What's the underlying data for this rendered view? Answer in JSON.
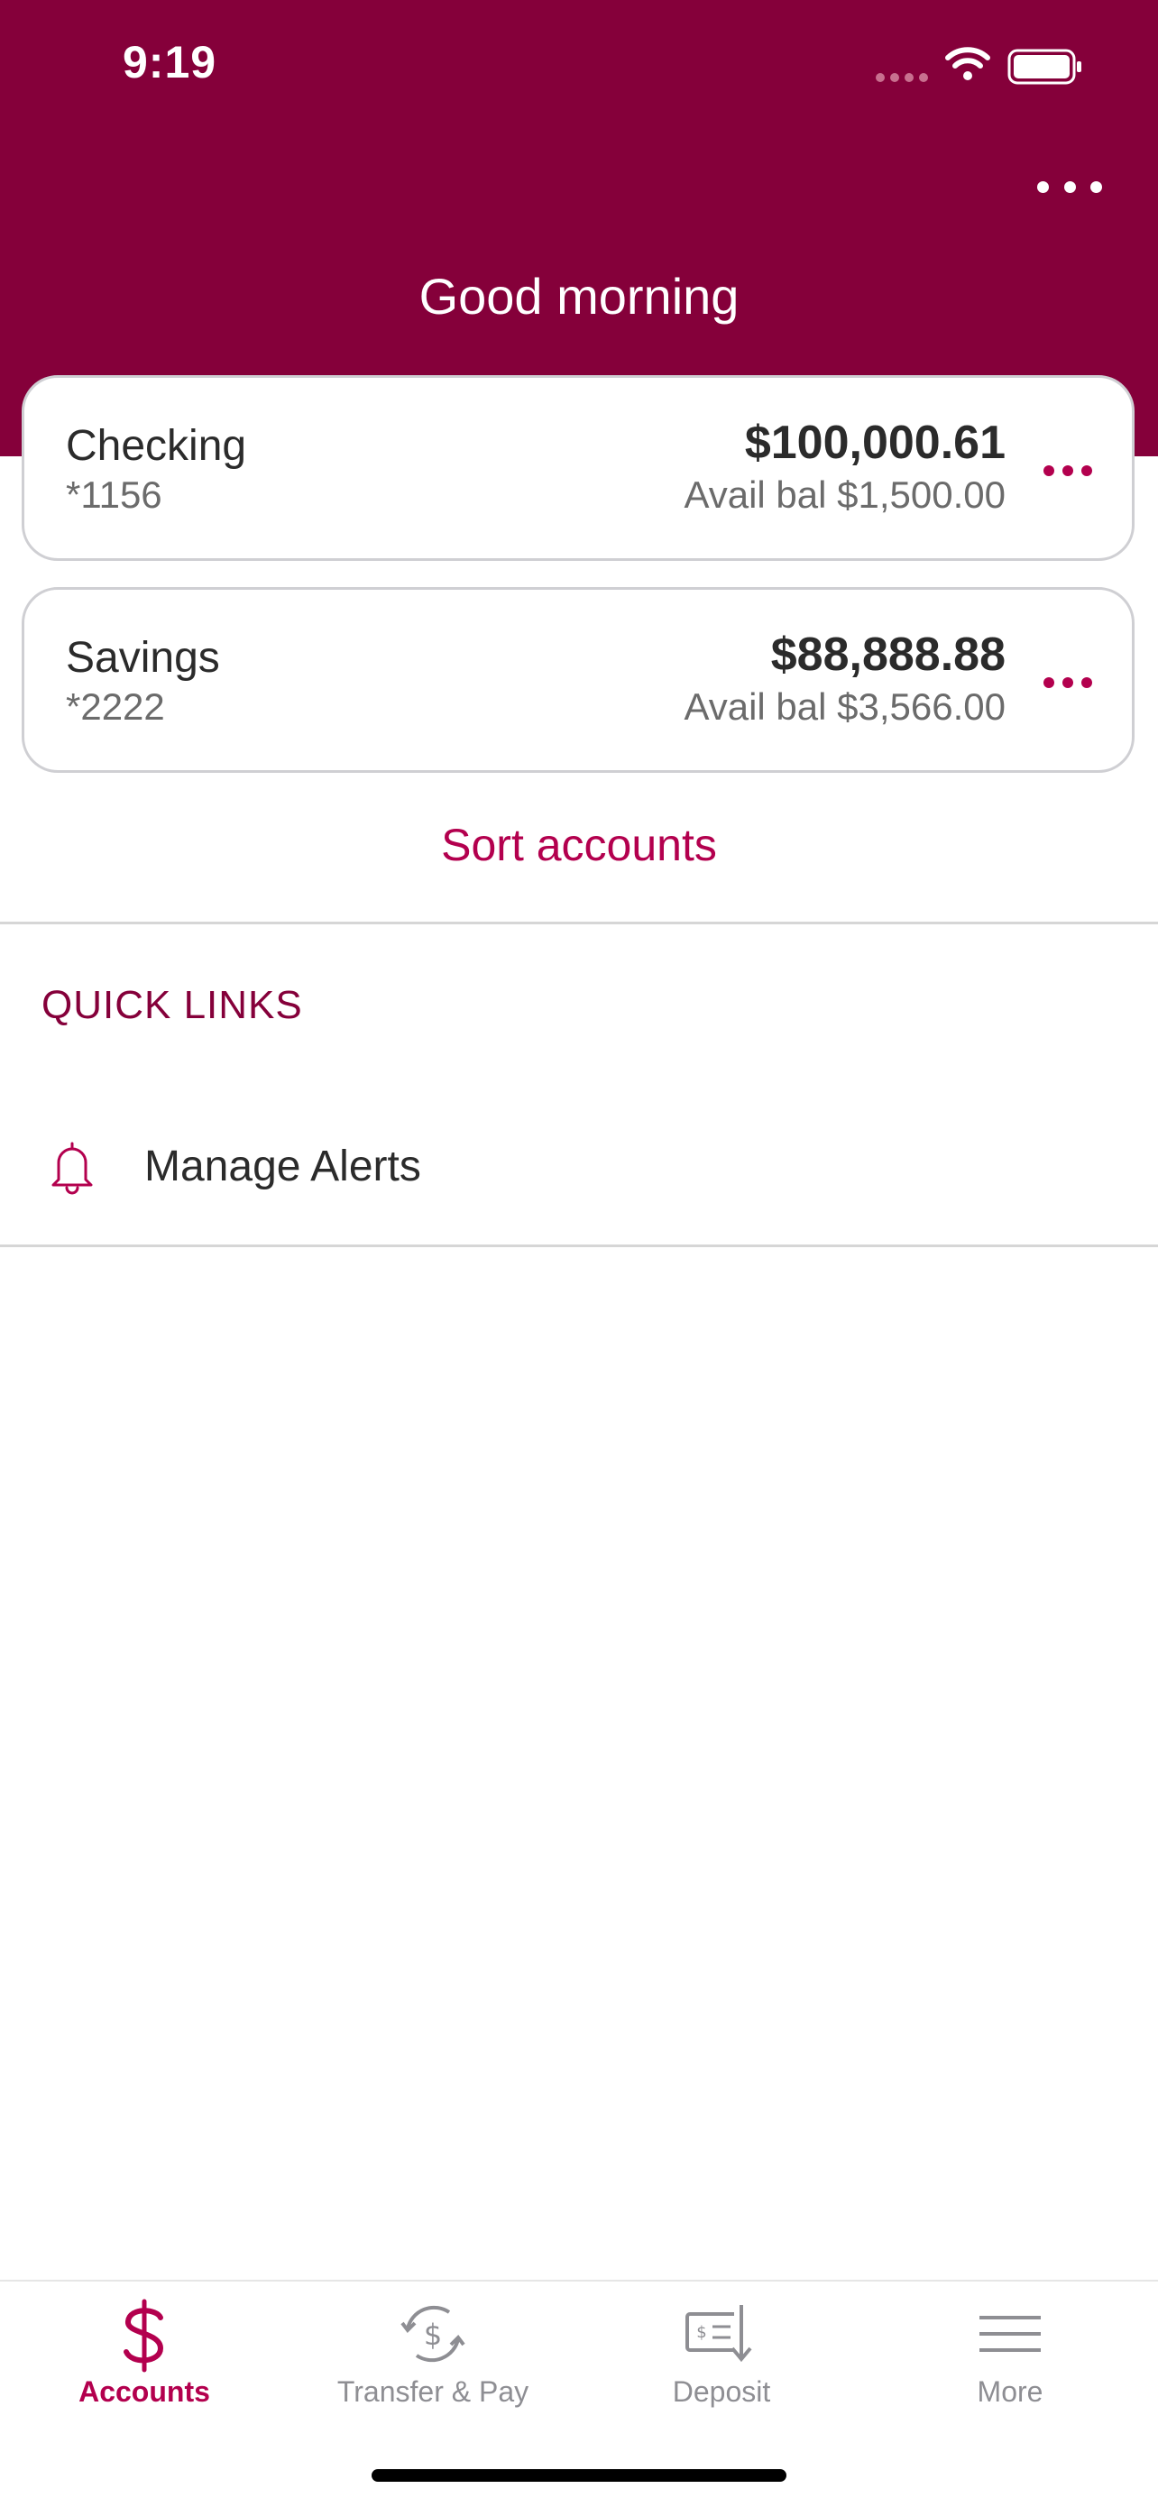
{
  "status_bar": {
    "time": "9:19"
  },
  "header": {
    "greeting": "Good morning",
    "more_icon": "more-horizontal-icon"
  },
  "accounts": [
    {
      "name": "Checking",
      "number": "*1156",
      "balance": "$100,000.61",
      "available": "Avail bal $1,500.00"
    },
    {
      "name": "Savings",
      "number": "*2222",
      "balance": "$88,888.88",
      "available": "Avail bal $3,566.00"
    }
  ],
  "sort_label": "Sort accounts",
  "quick_links": {
    "title": "QUICK LINKS",
    "items": [
      {
        "label": "Manage Alerts",
        "icon": "bell-icon"
      }
    ]
  },
  "tabs": [
    {
      "label": "Accounts",
      "icon": "dollar-icon",
      "active": true
    },
    {
      "label": "Transfer & Pay",
      "icon": "transfer-pay-icon",
      "active": false
    },
    {
      "label": "Deposit",
      "icon": "check-deposit-icon",
      "active": false
    },
    {
      "label": "More",
      "icon": "menu-icon",
      "active": false
    }
  ],
  "colors": {
    "brand": "#85003a",
    "accent": "#b3004e"
  }
}
